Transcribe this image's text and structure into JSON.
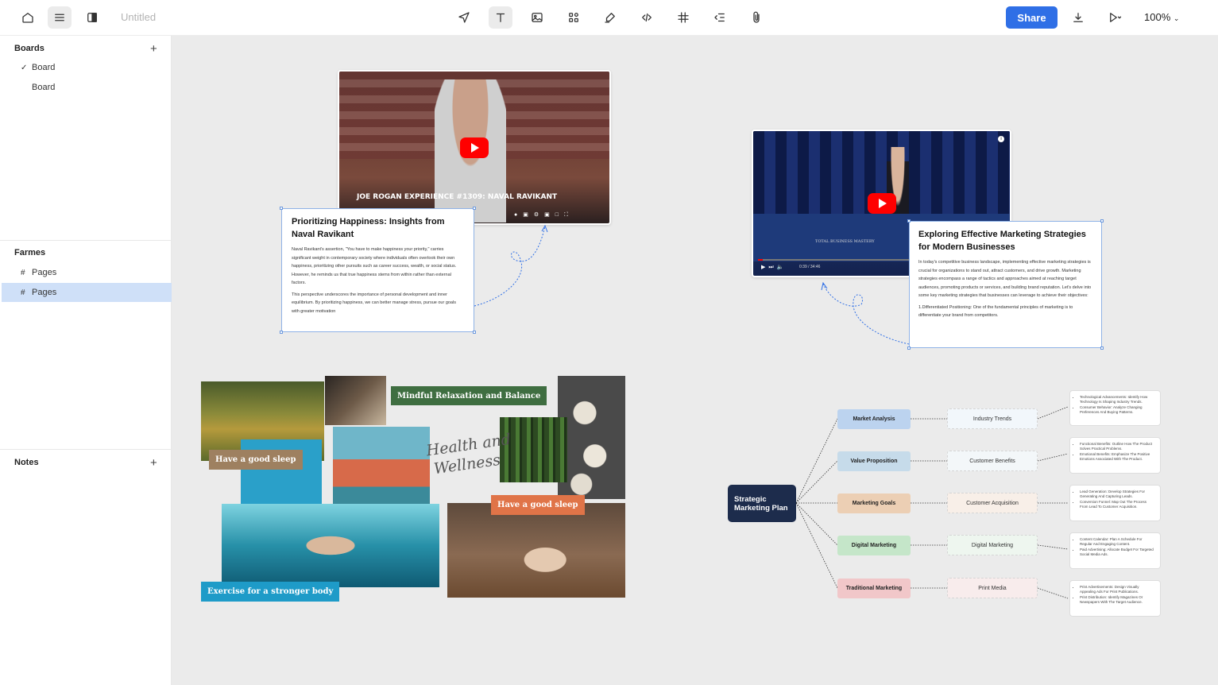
{
  "header": {
    "title": "Untitled",
    "share_label": "Share",
    "zoom": "100%",
    "tools": [
      "home-icon",
      "menu-icon",
      "panel-icon",
      "cursor-icon",
      "text-icon",
      "image-icon",
      "components-icon",
      "pen-icon",
      "code-icon",
      "frame-icon",
      "list-icon",
      "attach-icon"
    ]
  },
  "sidebar": {
    "boards_title": "Boards",
    "boards": [
      {
        "label": "Board",
        "checked": true
      },
      {
        "label": "Board",
        "checked": false
      }
    ],
    "frames_title": "Farmes",
    "frames": [
      {
        "label": "Pages",
        "selected": false
      },
      {
        "label": "Pages",
        "selected": true
      }
    ],
    "notes_title": "Notes"
  },
  "canvas": {
    "card1": {
      "title": "Prioritizing Happiness: Insights from Naval Ravikant",
      "p1": "Naval Ravikant's assertion, \"You have to make happiness your priority,\" carries significant weight in contemporary society where individuals often overlook their own happiness, prioritizing other pursuits such as career success, wealth, or social status. However, he reminds us that true happiness stems from within rather than external factors.",
      "p2": "This perspective underscores the importance of personal development and inner equilibrium. By prioritizing happiness, we can better manage stress, pursue our goals with greater motivation"
    },
    "video1": {
      "caption": "JOE ROGAN EXPERIENCE #1309: NAVAL RAVIKANT"
    },
    "card2": {
      "title": "Exploring Effective Marketing Strategies for Modern Businesses",
      "p1": "In today's competitive business landscape, implementing effective marketing strategies is crucial for organizations to stand out, attract customers, and drive growth. Marketing strategies encompass a range of tactics and approaches aimed at reaching target audiences, promoting products or services, and building brand reputation. Let's delve into some key marketing strategies that businesses can leverage to achieve their objectives:",
      "p2": "1.Differentiated Positioning: One of the fundamental principles of marketing is to differentiate your brand from competitors."
    },
    "video2": {
      "time": "0:39 / 34:46",
      "podium": "TOTAL BUSINESS MASTERY"
    },
    "moodboard": {
      "tag_mindful": "Mindful Relaxation and Balance",
      "tag_sleep1": "Have a good sleep",
      "tag_sleep2": "Have a good sleep",
      "tag_exercise": "Exercise for a stronger body",
      "script_line1": "Health and",
      "script_line2": "Wellness"
    },
    "mindmap": {
      "root": "Strategic Marketing Plan",
      "branches": [
        {
          "label": "Market Analysis",
          "sub": "Industry Trends",
          "color": "#bcd3ef",
          "details": [
            "Technological Advancements: Identify How Technology Is Shaping Industry Trends.",
            "Consumer Behavior: Analyze Changing Preferences And Buying Patterns."
          ]
        },
        {
          "label": "Value Proposition",
          "sub": "Customer Benefits",
          "color": "#c6dbea",
          "details": [
            "Functional Benefits: Outline How The Product Solves Practical Problems.",
            "Emotional Benefits: Emphasize The Positive Emotions Associated With The Product."
          ]
        },
        {
          "label": "Marketing Goals",
          "sub": "Customer Acquisition",
          "color": "#eccfb4",
          "details": [
            "Lead Generation: Develop Strategies For Generating And Capturing Leads.",
            "Conversion Funnel: Map Out The Process From Lead To Customer Acquisition."
          ]
        },
        {
          "label": "Digital Marketing",
          "sub": "Digital Marketing",
          "color": "#c5e6c9",
          "details": [
            "Content Calendar: Plan A Schedule For Regular And Engaging Content.",
            "Paid Advertising: Allocate Budget For Targeted Social Media Ads."
          ]
        },
        {
          "label": "Traditional Marketing",
          "sub": "Print Media",
          "color": "#f1c7c9",
          "details": [
            "Print Advertisements: Design Visually Appealing Ads For Print Publications.",
            "Print Distribution: Identify Magazines Or Newspapers With The Target Audience."
          ]
        }
      ]
    }
  }
}
